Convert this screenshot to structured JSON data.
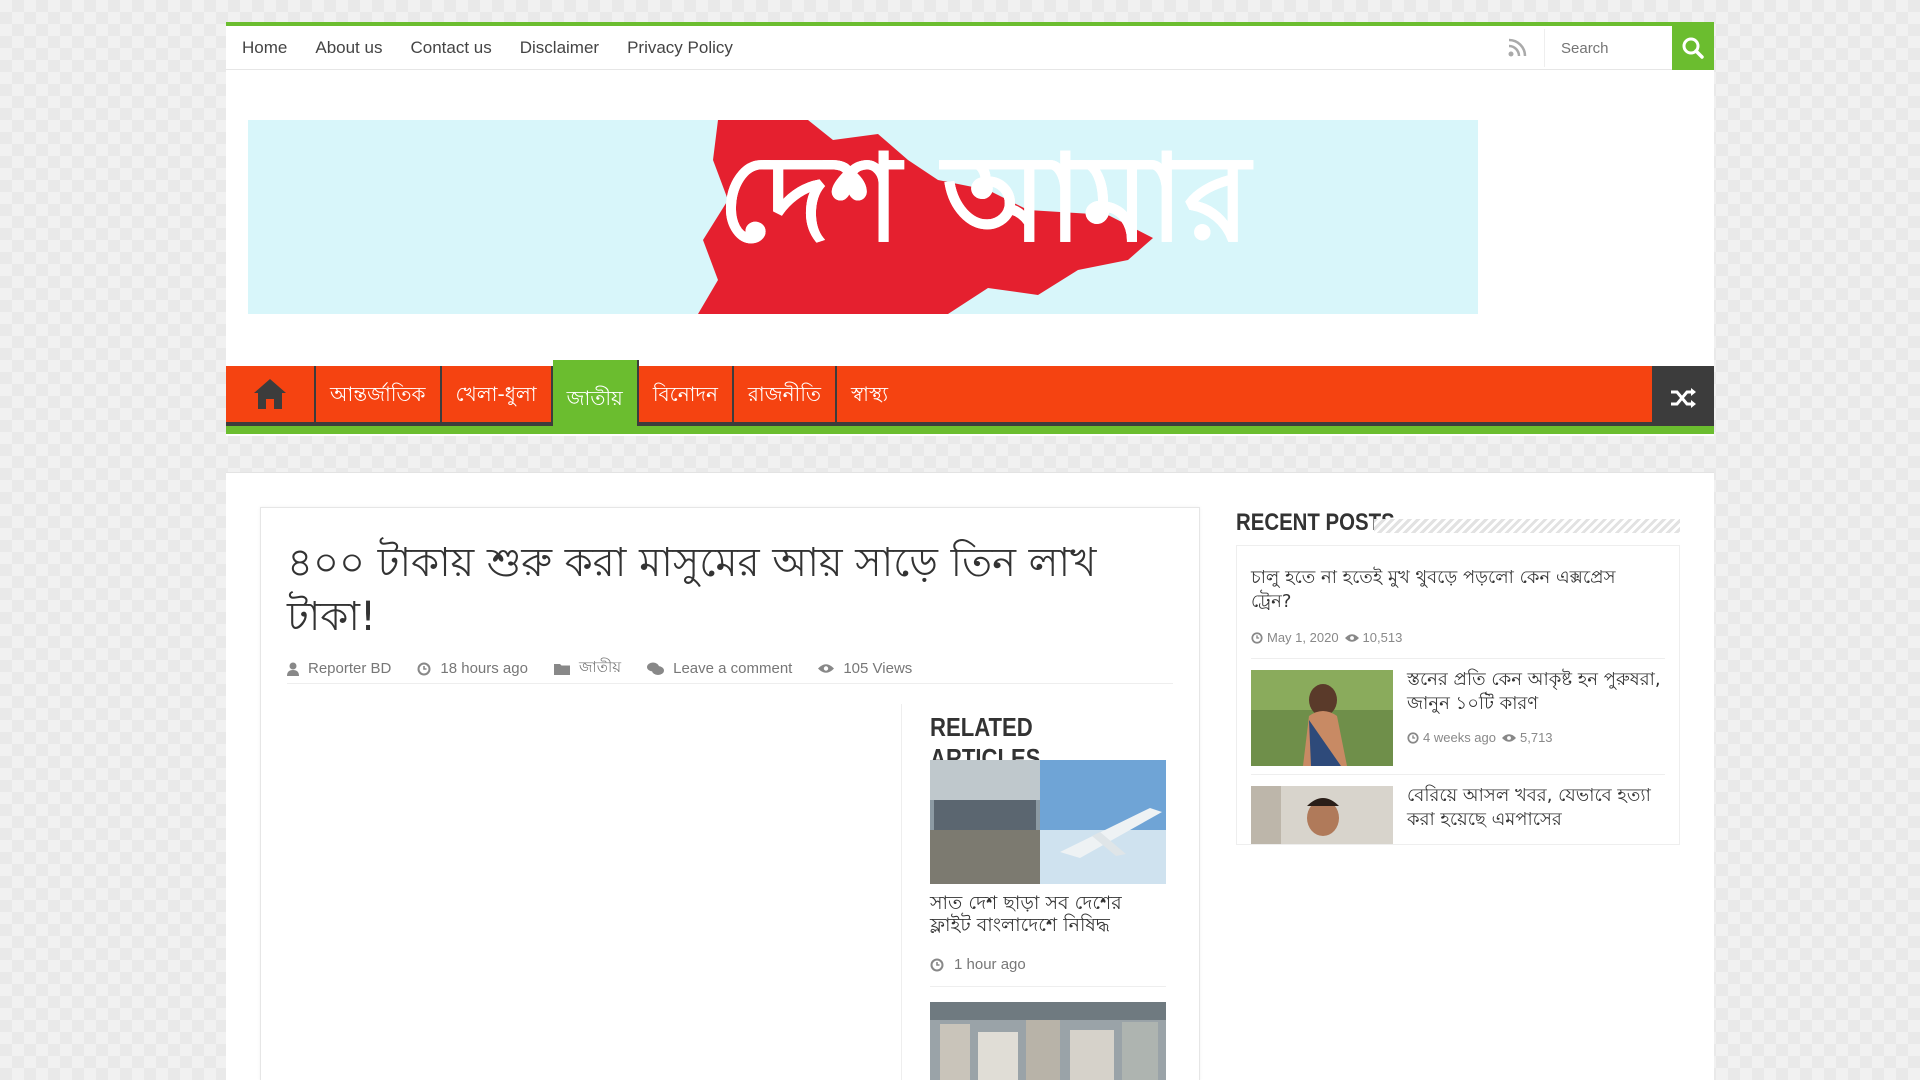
{
  "top_nav": {
    "links": [
      "Home",
      "About us",
      "Contact us",
      "Disclaimer",
      "Privacy Policy"
    ],
    "search_placeholder": "Search"
  },
  "logo": {
    "text": "দেশ আমার"
  },
  "main_nav": {
    "items": [
      "আন্তর্জাতিক",
      "খেলা-ধুলা",
      "জাতীয়",
      "বিনোদন",
      "রাজনীতি",
      "স্বাস্থ্য"
    ],
    "active": "জাতীয়"
  },
  "post": {
    "title": "৪০০ টাকায় শুরু করা মাসুমের আয় সাড়ে তিন লাখ টাকা!",
    "author": "Reporter BD",
    "time": "18 hours ago",
    "category": "জাতীয়",
    "comments": "Leave a comment",
    "views": "105 Views"
  },
  "related": {
    "heading": "RELATED ARTICLES",
    "items": [
      {
        "title": "সাত দেশ ছাড়া সব দেশের ফ্লাইট বাংলাদেশে নিষিদ্ধ",
        "time": "1 hour ago"
      }
    ]
  },
  "sidebar": {
    "heading": "RECENT POSTS",
    "posts": [
      {
        "title": "চালু হতে না হতেই মুখ থুবড়ে পড়লো কেন এক্সপ্রেস ট্রেন?",
        "date": "May 1, 2020",
        "views": "10,513"
      },
      {
        "title": "স্তনের প্রতি কেন আকৃষ্ট হন পুরুষরা, জানুন ১০টি কারণ",
        "date": "4 weeks ago",
        "views": "5,713"
      },
      {
        "title": "বেরিয়ে আসল খবর, যেভাবে হত্যা করা হয়েছে এমপাসের"
      }
    ]
  },
  "colors": {
    "accent_green": "#6bbd2f",
    "nav_orange": "#f54311",
    "dark": "#3c3c3c"
  }
}
